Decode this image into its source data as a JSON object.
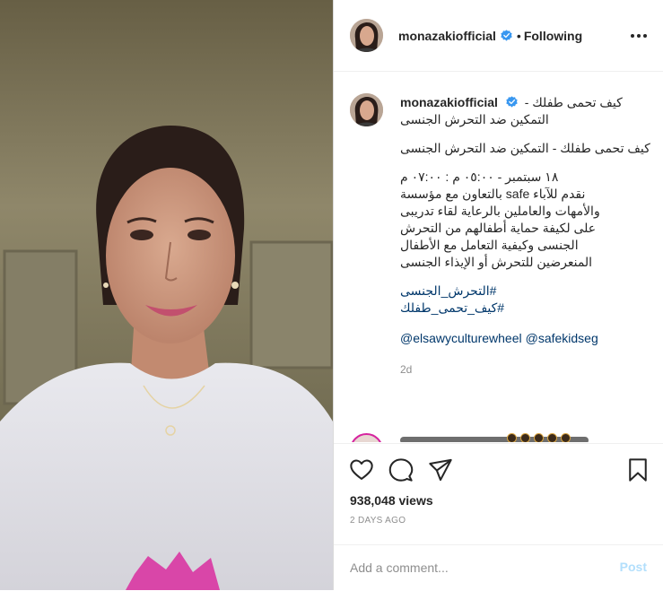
{
  "post": {
    "username": "monazakiofficial",
    "separator": "•",
    "follow_state": "Following",
    "views": "938,048 views",
    "date": "2 DAYS AGO"
  },
  "caption": {
    "username": "monazakiofficial",
    "title": "كيف تحمى طفلك -",
    "title_line2": "التمكين ضد التحرش الجنسى",
    "para1": "كيف تحمى طفلك - التمكين ضد التحرش الجنسى",
    "para2_line1": "١٨ سبتمبر - ٠٥:٠٠ م : ٠٧:٠٠ م",
    "para2_line2": "نقدم للآباء safe بالتعاون مع مؤسسة",
    "para2_line3": "والأمهات والعاملين بالرعاية لقاء تدريبى",
    "para2_line4": "على لكيفة حماية أطفالهم من التحرش",
    "para2_line5": "الجنسى وكيفية التعامل مع الأطفال",
    "para2_line6": "المنعرضين للتحرش أو الإيذاء الجنسى",
    "hashtag1": "#التحرش_الجنسى",
    "hashtag2": "#كيف_تحمى_طفلك",
    "mention1": "@elsawyculturewheel",
    "mention2": "@safekidseg",
    "time_ago": "2d"
  },
  "comment_box": {
    "placeholder": "Add a comment...",
    "post_label": "Post"
  },
  "colors": {
    "verified": "#3897f0",
    "link": "#00376b",
    "muted": "#8e8e8e",
    "post_disabled": "#b2dffc"
  },
  "icons": [
    "verified-badge-icon",
    "more-options-icon",
    "heart-icon",
    "comment-icon",
    "share-icon",
    "bookmark-icon"
  ]
}
